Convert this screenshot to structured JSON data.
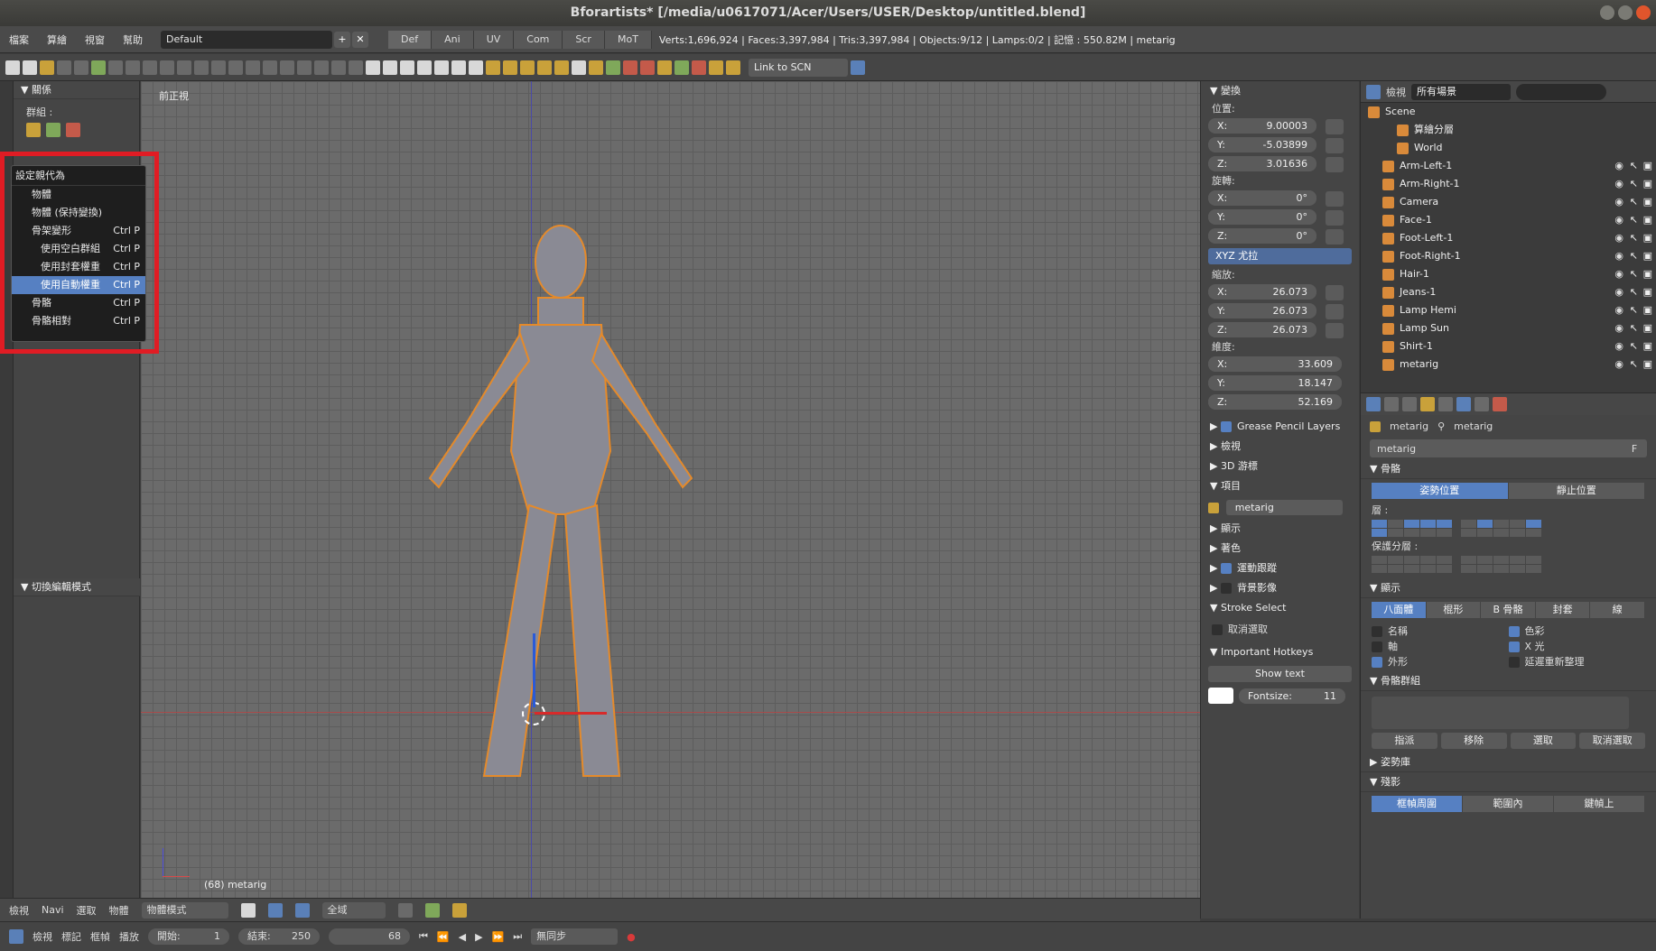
{
  "window": {
    "title": "Bforartists* [/media/u0617071/Acer/Users/USER/Desktop/untitled.blend]"
  },
  "menubar": {
    "items": [
      "檔案",
      "算繪",
      "視窗",
      "幫助"
    ],
    "layout": "Default",
    "tabs": [
      "Def",
      "Ani",
      "UV",
      "Com",
      "Scr",
      "MoT"
    ],
    "stats": "Verts:1,696,924 | Faces:3,397,984 | Tris:3,397,984 | Objects:9/12 | Lamps:0/2 | 記憶 : 550.82M | metarig"
  },
  "toolbar": {
    "link_select": "Link to SCN"
  },
  "left_panel": {
    "section_relations": "關係",
    "group_label": "群組 :",
    "section_toggle_edit": "切換編輯模式"
  },
  "popup": {
    "title": "設定親代為",
    "items": [
      {
        "label": "物體",
        "shortcut": ""
      },
      {
        "label": "物體 (保持變換)",
        "shortcut": ""
      },
      {
        "label": "骨架變形",
        "shortcut": "Ctrl P"
      },
      {
        "label": "使用空白群組",
        "shortcut": "Ctrl P"
      },
      {
        "label": "使用封套權重",
        "shortcut": "Ctrl P"
      },
      {
        "label": "使用自動權重",
        "shortcut": "Ctrl P"
      },
      {
        "label": "骨骼",
        "shortcut": "Ctrl P"
      },
      {
        "label": "骨骼相對",
        "shortcut": "Ctrl P"
      }
    ]
  },
  "viewport": {
    "view_label": "前正視",
    "object_label": "(68) metarig"
  },
  "transform": {
    "title": "變換",
    "location_label": "位置:",
    "location": [
      {
        "axis": "X:",
        "value": "9.00003"
      },
      {
        "axis": "Y:",
        "value": "-5.03899"
      },
      {
        "axis": "Z:",
        "value": "3.01636"
      }
    ],
    "rotation_label": "旋轉:",
    "rotation": [
      {
        "axis": "X:",
        "value": "0°"
      },
      {
        "axis": "Y:",
        "value": "0°"
      },
      {
        "axis": "Z:",
        "value": "0°"
      }
    ],
    "rotation_mode": "XYZ 尤拉",
    "scale_label": "縮放:",
    "scale": [
      {
        "axis": "X:",
        "value": "26.073"
      },
      {
        "axis": "Y:",
        "value": "26.073"
      },
      {
        "axis": "Z:",
        "value": "26.073"
      }
    ],
    "dims_label": "維度:",
    "dims": [
      {
        "axis": "X:",
        "value": "33.609"
      },
      {
        "axis": "Y:",
        "value": "18.147"
      },
      {
        "axis": "Z:",
        "value": "52.169"
      }
    ],
    "sections": [
      "Grease Pencil Layers",
      "檢視",
      "3D 游標",
      "項目"
    ],
    "item_name": "metarig",
    "sections2": [
      "顯示",
      "著色",
      "運動跟蹤",
      "背景影像",
      "Stroke Select"
    ],
    "deselect": "取消選取",
    "hotkeys": "Important Hotkeys",
    "show_text": "Show text",
    "fontsize_label": "Fontsize:",
    "fontsize_value": "11"
  },
  "outliner": {
    "view_label": "檢視",
    "scope": "所有場景",
    "rows": [
      {
        "label": "Scene",
        "indent": 0
      },
      {
        "label": "算繪分層",
        "indent": 2
      },
      {
        "label": "World",
        "indent": 2
      },
      {
        "label": "Arm-Left-1",
        "indent": 1
      },
      {
        "label": "Arm-Right-1",
        "indent": 1
      },
      {
        "label": "Camera",
        "indent": 1
      },
      {
        "label": "Face-1",
        "indent": 1
      },
      {
        "label": "Foot-Left-1",
        "indent": 1
      },
      {
        "label": "Foot-Right-1",
        "indent": 1
      },
      {
        "label": "Hair-1",
        "indent": 1
      },
      {
        "label": "Jeans-1",
        "indent": 1
      },
      {
        "label": "Lamp Hemi",
        "indent": 1
      },
      {
        "label": "Lamp Sun",
        "indent": 1
      },
      {
        "label": "Shirt-1",
        "indent": 1
      },
      {
        "label": "metarig",
        "indent": 1
      }
    ]
  },
  "properties": {
    "crumb1": "metarig",
    "crumb2": "metarig",
    "datablock": "metarig",
    "fake": "F",
    "skeleton": "骨骼",
    "pose_position": "姿勢位置",
    "rest_position": "靜止位置",
    "layers_label": "層 :",
    "protected_label": "保護分層 :",
    "display": "顯示",
    "display_types": [
      "八面體",
      "棍形",
      "B 骨骼",
      "封套",
      "線"
    ],
    "opts_left": [
      "名稱",
      "軸",
      "外形"
    ],
    "opts_right": [
      "色彩",
      "X 光",
      "延遲重新整理"
    ],
    "bone_groups": "骨骼群組",
    "bg_buttons": [
      "指派",
      "移除",
      "選取",
      "取消選取"
    ],
    "pose_library": "姿勢庫",
    "ghost": "殘影",
    "ghost_types": [
      "框幀周圍",
      "範圍內",
      "鍵幀上"
    ]
  },
  "bottom": {
    "row1": [
      "檢視",
      "Navi",
      "選取",
      "物體"
    ],
    "mode": "物體模式",
    "global": "全域",
    "row2": [
      "檢視",
      "標記",
      "框幀",
      "播放"
    ],
    "start_label": "開始:",
    "start_value": "1",
    "end_label": "結束:",
    "end_value": "250",
    "current": "68",
    "sync": "無同步"
  },
  "colors": {
    "accent": "#5680c2",
    "highlight": "#e01c24",
    "rig": "#e58a2a"
  }
}
